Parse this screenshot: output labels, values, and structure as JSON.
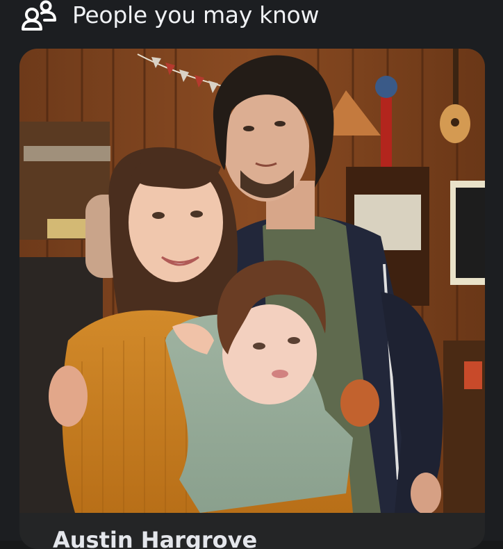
{
  "section": {
    "title": "People you may know",
    "icon": "people-icon"
  },
  "suggestion": {
    "name": "Austin Hargrove",
    "photo_alt": "Profile photo",
    "photo_icon": "profile-photo"
  },
  "colors": {
    "page_background": "#18191a",
    "card_background": "#242526",
    "title_text": "#f0f2f5"
  }
}
